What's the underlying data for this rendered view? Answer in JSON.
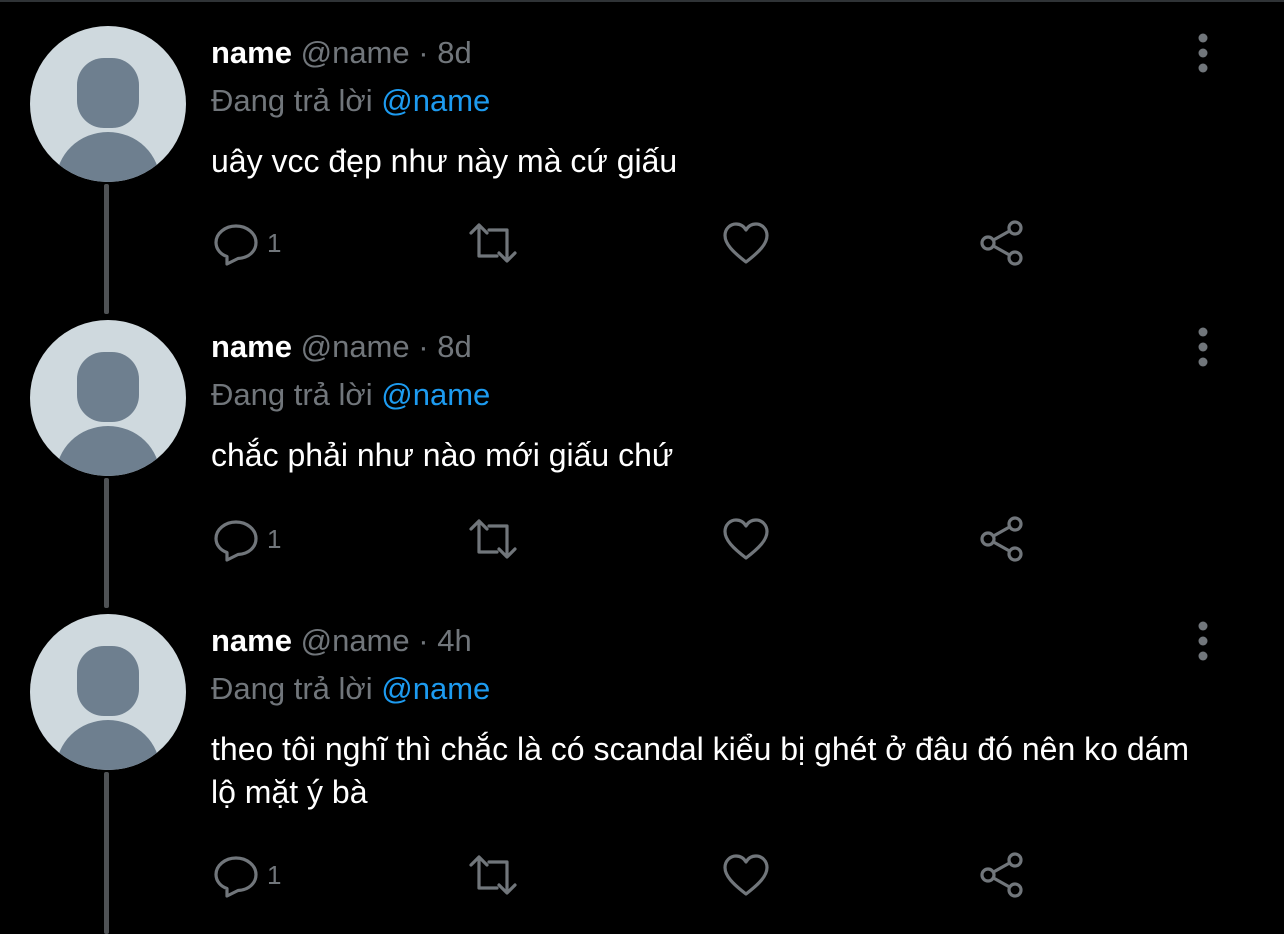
{
  "tweets": [
    {
      "display_name": "name",
      "handle": "@name",
      "separator": "·",
      "time": "8d",
      "reply_prefix": "Đang trả lời",
      "reply_to": "@name",
      "text": "uây vcc đẹp như này mà cứ giấu",
      "reply_count": "1"
    },
    {
      "display_name": "name",
      "handle": "@name",
      "separator": "·",
      "time": "8d",
      "reply_prefix": "Đang trả lời",
      "reply_to": "@name",
      "text": "chắc phải như nào mới giấu chứ",
      "reply_count": "1"
    },
    {
      "display_name": "name",
      "handle": "@name",
      "separator": "·",
      "time": "4h",
      "reply_prefix": "Đang trả lời",
      "reply_to": "@name",
      "text": "theo tôi nghĩ thì chắc là có scandal kiểu bị ghét ở đâu đó nên ko dám lộ mặt ý bà",
      "reply_count": "1"
    }
  ],
  "icons": {
    "reply": "reply-icon",
    "retweet": "retweet-icon",
    "like": "heart-icon",
    "share": "share-icon",
    "more": "more-vertical-icon",
    "avatar": "default-avatar-icon"
  },
  "colors": {
    "background": "#000000",
    "text_primary": "#ffffff",
    "text_secondary": "#71767b",
    "mention": "#1d9bf0",
    "avatar_bg": "#cfd9de",
    "avatar_figure": "#6e7f8f",
    "thread_line": "#4f5255"
  }
}
